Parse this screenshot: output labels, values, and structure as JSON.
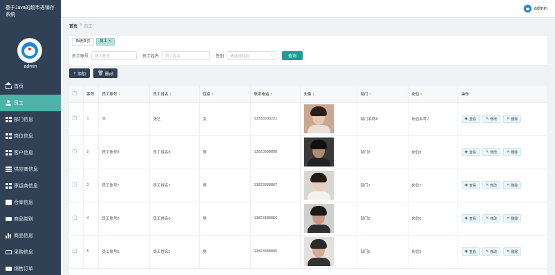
{
  "system_title": "基于Java的超市进销存系统",
  "user": {
    "name": "admin"
  },
  "sidebar": {
    "items": [
      {
        "label": "首页",
        "icon": "home-icon",
        "active": false
      },
      {
        "label": "员工",
        "icon": "user-icon",
        "active": true
      },
      {
        "label": "部门信息",
        "icon": "grid-icon",
        "active": false
      },
      {
        "label": "岗位信息",
        "icon": "grid-icon",
        "active": false
      },
      {
        "label": "客户信息",
        "icon": "grid-icon",
        "active": false
      },
      {
        "label": "供应商信息",
        "icon": "list-icon",
        "active": false
      },
      {
        "label": "承运商信息",
        "icon": "grid-icon",
        "active": false
      },
      {
        "label": "仓库信息",
        "icon": "box-icon",
        "active": false
      },
      {
        "label": "商品类别",
        "icon": "chat-icon",
        "active": false
      },
      {
        "label": "商品信息",
        "icon": "bar-chart-icon",
        "active": false
      },
      {
        "label": "采购信息",
        "icon": "cart-icon",
        "active": false
      },
      {
        "label": "销售订单",
        "icon": "monitor-icon",
        "active": false
      }
    ]
  },
  "header": {
    "username": "admin"
  },
  "breadcrumb": {
    "home": "首页",
    "separator": "≡",
    "current": "员工"
  },
  "tabs": [
    {
      "label": "系统首页"
    },
    {
      "label": "员工",
      "close": "×"
    }
  ],
  "search": {
    "emp_no_label": "员工账号",
    "emp_no_placeholder": "员工账号",
    "emp_name_label": "员工姓名",
    "emp_name_placeholder": "员工姓名",
    "gender_label": "性别",
    "gender_placeholder": "请选择性别",
    "query_button": "查询"
  },
  "toolbar": {
    "add": "添加",
    "delete": "删除"
  },
  "table": {
    "columns": [
      "索号",
      "员工账号",
      "员工姓名",
      "性别",
      "联系电话",
      "头像",
      "部门",
      "岗位",
      "操作"
    ],
    "rows": [
      {
        "idx": "1",
        "account": "11",
        "name": "张艺",
        "gender": "女",
        "phone": "13333333221",
        "dept": "部门名称8",
        "post": "岗位名称7"
      },
      {
        "idx": "2",
        "account": "员工账号8",
        "name": "员工姓名8",
        "gender": "男",
        "phone": "13823888888",
        "dept": "部门8",
        "post": "岗位8"
      },
      {
        "idx": "3",
        "account": "员工账号7",
        "name": "员工姓名7",
        "gender": "男",
        "phone": "13823888887",
        "dept": "部门7",
        "post": "岗位7"
      },
      {
        "idx": "4",
        "account": "员工账号6",
        "name": "员工姓名6",
        "gender": "男",
        "phone": "13823888886",
        "dept": "部门6",
        "post": "岗位6"
      },
      {
        "idx": "5",
        "account": "员工账号5",
        "name": "员工姓名5",
        "gender": "男",
        "phone": "13823888885",
        "dept": "部门5",
        "post": "岗位5"
      }
    ],
    "ops": {
      "view": "查看",
      "edit": "修改",
      "delete": "删除"
    }
  },
  "colors": {
    "sidebar": "#304156",
    "accent": "#4bb3a7",
    "query": "#1aa094"
  }
}
